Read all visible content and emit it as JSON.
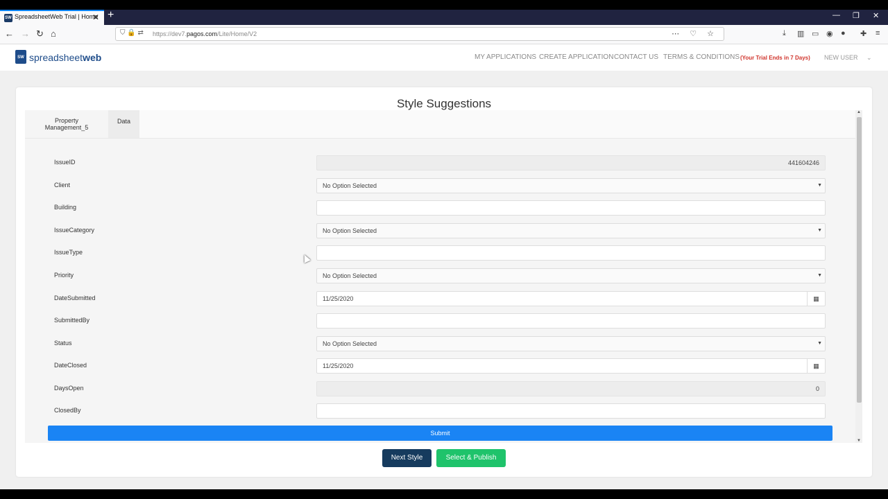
{
  "browser": {
    "tab_title": "SpreadsheetWeb Trial | Home",
    "tab_favicon": "SW",
    "url_prefix": "https://dev7.",
    "url_host": "pagos.com",
    "url_path": "/Lite/Home/V2"
  },
  "header": {
    "logo_prefix": "spreadsheet",
    "logo_bold": "web",
    "menu": [
      "MY APPLICATIONS",
      "CREATE APPLICATION",
      "CONTACT US",
      "TERMS & CONDITIONS"
    ],
    "trial_notice": "(Your Trial Ends in 7 Days)",
    "user": "NEW USER"
  },
  "page": {
    "title": "Style Suggestions",
    "tabs": [
      "Property Management_5",
      "Data"
    ]
  },
  "form": {
    "fields": [
      {
        "label": "IssueID",
        "type": "readonly",
        "value": "441604246"
      },
      {
        "label": "Client",
        "type": "select",
        "value": "No Option Selected"
      },
      {
        "label": "Building",
        "type": "text",
        "value": ""
      },
      {
        "label": "IssueCategory",
        "type": "select",
        "value": "No Option Selected"
      },
      {
        "label": "IssueType",
        "type": "text",
        "value": ""
      },
      {
        "label": "Priority",
        "type": "select",
        "value": "No Option Selected"
      },
      {
        "label": "DateSubmitted",
        "type": "date",
        "value": "11/25/2020"
      },
      {
        "label": "SubmittedBy",
        "type": "text",
        "value": ""
      },
      {
        "label": "Status",
        "type": "select",
        "value": "No Option Selected"
      },
      {
        "label": "DateClosed",
        "type": "date",
        "value": "11/25/2020"
      },
      {
        "label": "DaysOpen",
        "type": "readonly",
        "value": "0"
      },
      {
        "label": "ClosedBy",
        "type": "text",
        "value": ""
      }
    ],
    "submit_label": "Submit"
  },
  "actions": {
    "next_style": "Next Style",
    "select_publish": "Select & Publish"
  },
  "colors": {
    "accent_blue": "#1a84f4",
    "navy": "#163b5e",
    "green": "#1fc36b",
    "trial_red": "#d0342c"
  }
}
